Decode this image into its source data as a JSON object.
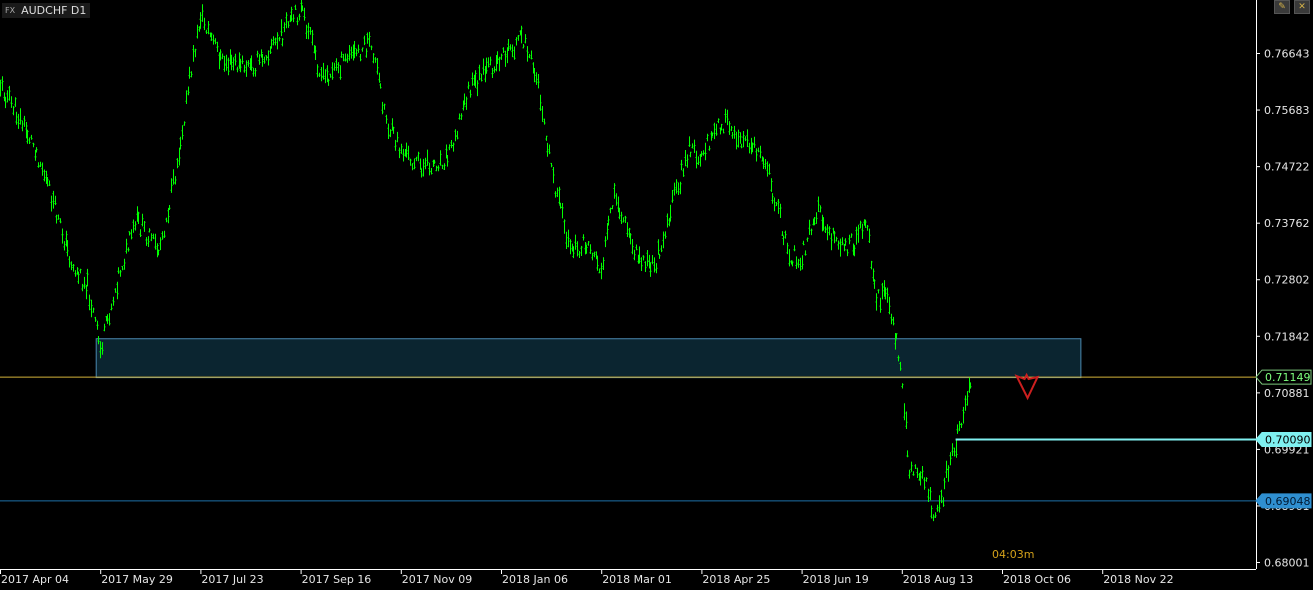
{
  "header": {
    "badge_prefix": "FX",
    "symbol": "AUDCHF D1",
    "tool_icons": [
      "pencil-icon",
      "close-icon"
    ]
  },
  "timer": "04:03m",
  "colors": {
    "background": "#000000",
    "price_line": "#00ff00",
    "axis": "#ffffff",
    "current_price_line": "#d4b33a",
    "target_line_1": "#7ff0f0",
    "target_line_2": "#1e6fa8",
    "zone_fill": "#0b2530",
    "zone_border": "#4a88b0",
    "arrow": "#cc1f1f"
  },
  "chart_data": {
    "type": "bar",
    "symbol": "AUDCHF",
    "timeframe": "D1",
    "x_labels": [
      "2017 Apr 04",
      "2017 May 29",
      "2017 Jul 23",
      "2017 Sep 16",
      "2017 Nov 09",
      "2018 Jan 06",
      "2018 Mar 01",
      "2018 Apr 25",
      "2018 Jun 19",
      "2018 Aug 13",
      "2018 Oct 06",
      "2018 Nov 22"
    ],
    "y_ticks": [
      "0.76643",
      "0.75683",
      "0.74722",
      "0.73762",
      "0.72802",
      "0.71842",
      "0.70881",
      "0.69921",
      "0.68961",
      "0.68001"
    ],
    "ylim": [
      0.68,
      0.777
    ],
    "price_path": [
      {
        "date": "2017 Apr 04",
        "price": 0.761
      },
      {
        "date": "2017 Apr 10",
        "price": 0.758
      },
      {
        "date": "2017 Apr 24",
        "price": 0.75
      },
      {
        "date": "2017 May 06",
        "price": 0.738
      },
      {
        "date": "2017 May 14",
        "price": 0.73
      },
      {
        "date": "2017 May 22",
        "price": 0.727
      },
      {
        "date": "2017 May 29",
        "price": 0.716
      },
      {
        "date": "2017 Jun 08",
        "price": 0.729
      },
      {
        "date": "2017 Jun 18",
        "price": 0.738
      },
      {
        "date": "2017 Jun 30",
        "price": 0.733
      },
      {
        "date": "2017 Jul 08",
        "price": 0.744
      },
      {
        "date": "2017 Jul 16",
        "price": 0.76
      },
      {
        "date": "2017 Jul 23",
        "price": 0.773
      },
      {
        "date": "2017 Aug 04",
        "price": 0.765
      },
      {
        "date": "2017 Aug 20",
        "price": 0.764
      },
      {
        "date": "2017 Sep 04",
        "price": 0.769
      },
      {
        "date": "2017 Sep 16",
        "price": 0.774
      },
      {
        "date": "2017 Sep 28",
        "price": 0.762
      },
      {
        "date": "2017 Oct 12",
        "price": 0.766
      },
      {
        "date": "2017 Oct 24",
        "price": 0.768
      },
      {
        "date": "2017 Nov 02",
        "price": 0.754
      },
      {
        "date": "2017 Nov 09",
        "price": 0.75
      },
      {
        "date": "2017 Nov 22",
        "price": 0.747
      },
      {
        "date": "2017 Dec 06",
        "price": 0.749
      },
      {
        "date": "2017 Dec 18",
        "price": 0.76
      },
      {
        "date": "2018 Jan 06",
        "price": 0.766
      },
      {
        "date": "2018 Jan 18",
        "price": 0.769
      },
      {
        "date": "2018 Jan 26",
        "price": 0.761
      },
      {
        "date": "2018 Feb 04",
        "price": 0.744
      },
      {
        "date": "2018 Feb 12",
        "price": 0.733
      },
      {
        "date": "2018 Feb 22",
        "price": 0.734
      },
      {
        "date": "2018 Mar 01",
        "price": 0.73
      },
      {
        "date": "2018 Mar 08",
        "price": 0.742
      },
      {
        "date": "2018 Mar 20",
        "price": 0.732
      },
      {
        "date": "2018 Mar 30",
        "price": 0.73
      },
      {
        "date": "2018 Apr 08",
        "price": 0.74
      },
      {
        "date": "2018 Apr 18",
        "price": 0.75
      },
      {
        "date": "2018 Apr 25",
        "price": 0.749
      },
      {
        "date": "2018 May 06",
        "price": 0.755
      },
      {
        "date": "2018 May 18",
        "price": 0.752
      },
      {
        "date": "2018 May 28",
        "price": 0.75
      },
      {
        "date": "2018 Jun 04",
        "price": 0.742
      },
      {
        "date": "2018 Jun 12",
        "price": 0.732
      },
      {
        "date": "2018 Jun 19",
        "price": 0.732
      },
      {
        "date": "2018 Jun 28",
        "price": 0.74
      },
      {
        "date": "2018 Jul 08",
        "price": 0.734
      },
      {
        "date": "2018 Jul 18",
        "price": 0.734
      },
      {
        "date": "2018 Jul 24",
        "price": 0.739
      },
      {
        "date": "2018 Jul 30",
        "price": 0.724
      },
      {
        "date": "2018 Aug 04",
        "price": 0.727
      },
      {
        "date": "2018 Aug 10",
        "price": 0.717
      },
      {
        "date": "2018 Aug 13",
        "price": 0.71
      },
      {
        "date": "2018 Aug 17",
        "price": 0.696
      },
      {
        "date": "2018 Aug 24",
        "price": 0.695
      },
      {
        "date": "2018 Aug 30",
        "price": 0.688
      },
      {
        "date": "2018 Sep 03",
        "price": 0.69
      },
      {
        "date": "2018 Sep 07",
        "price": 0.696
      },
      {
        "date": "2018 Sep 13",
        "price": 0.703
      },
      {
        "date": "2018 Sep 18",
        "price": 0.71
      },
      {
        "date": "2018 Sep 20",
        "price": 0.7115
      }
    ],
    "resistance_zone": {
      "from_date": "2017 May 29",
      "to_date": "2018 Nov 12",
      "low": 0.7114,
      "high": 0.718
    },
    "current_price": {
      "value": "0.71149",
      "color": "#d4b33a"
    },
    "horizontal_lines": [
      {
        "value": "0.70090",
        "color": "#7ff0f0",
        "from_date": "2018 Sep 11"
      },
      {
        "value": "0.69048",
        "color": "#1e6fa8",
        "from_date": "2017 Apr 04"
      }
    ],
    "arrow": {
      "direction": "down",
      "date": "2018 Oct 18",
      "color": "#cc1f1f"
    },
    "grid": false
  }
}
